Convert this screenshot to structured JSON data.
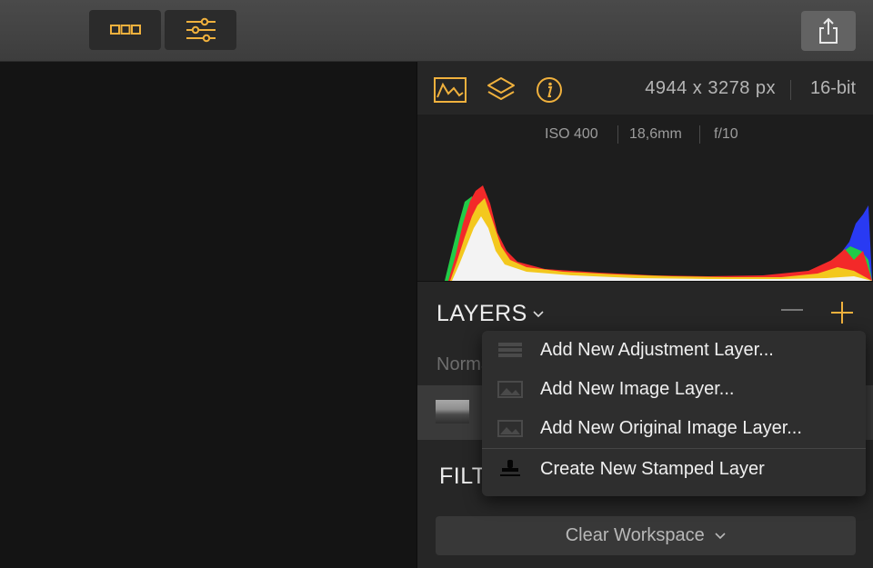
{
  "toolbar": {
    "browse_icon": "three-boxes-icon",
    "adjust_icon": "sliders-icon",
    "share_icon": "share-icon"
  },
  "info": {
    "dimensions": "4944 x 3278 px",
    "bit_depth": "16-bit",
    "tabs": [
      "histogram-icon",
      "layers-icon",
      "info-icon"
    ],
    "accent_color": "#f0b13d"
  },
  "exif": {
    "iso": "ISO 400",
    "focal_length": "18,6mm",
    "aperture": "f/10"
  },
  "layers": {
    "title": "LAYERS",
    "blend_mode": "Normal"
  },
  "filters": {
    "title": "FILTERS"
  },
  "workspace": {
    "label": "Clear Workspace"
  },
  "add_layer_menu": {
    "items": [
      {
        "label": "Add New Adjustment Layer...",
        "icon": "adjustment-layer-icon"
      },
      {
        "label": "Add New Image Layer...",
        "icon": "image-layer-icon"
      },
      {
        "label": "Add New Original Image Layer...",
        "icon": "original-image-layer-icon"
      },
      {
        "label": "Create New Stamped Layer",
        "icon": "stamp-icon"
      }
    ]
  }
}
